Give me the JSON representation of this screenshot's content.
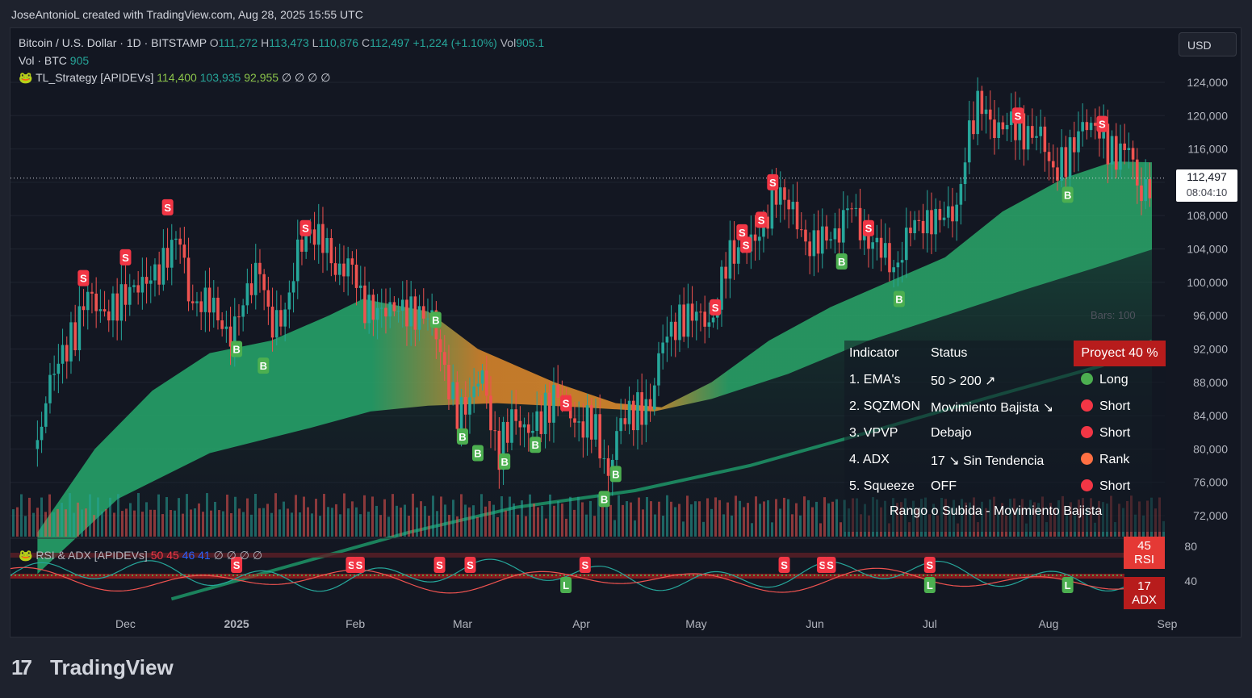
{
  "header": {
    "credit": "JoseAntonioL created with TradingView.com, Aug 28, 2025 15:55 UTC"
  },
  "legend": {
    "symbol": "Bitcoin / U.S. Dollar · 1D · BITSTAMP",
    "o_label": "O",
    "o_value": "111,272",
    "h_label": "H",
    "h_value": "113,473",
    "l_label": "L",
    "l_value": "110,876",
    "c_label": "C",
    "c_value": "112,497",
    "change": "+1,224 (+1.10%)",
    "vol_label": "Vol",
    "vol_value": "905.1",
    "vol_line_label": "Vol · BTC",
    "vol_line_value": "905",
    "strategy_name": "TL_Strategy [APIDEVs]",
    "strategy_v1": "114,400",
    "strategy_v2": "103,935",
    "strategy_v3": "92,955",
    "strategy_rest": "∅ ∅ ∅ ∅",
    "rsi_name": "RSI & ADX [APIDEVs]",
    "rsi_v1": "50",
    "rsi_v2": "45",
    "rsi_v3": "46",
    "rsi_v4": "41",
    "rsi_rest": "∅ ∅ ∅ ∅"
  },
  "currency": "USD",
  "price_tag": {
    "price": "112,497",
    "countdown": "08:04:10"
  },
  "bars_label": "Bars: 100",
  "table": {
    "headers": [
      "Indicator",
      "Status",
      "Proyect 40 %"
    ],
    "rows": [
      {
        "indicator": "1. EMA's",
        "status": "50 > 200 ↗",
        "signal": "Long",
        "color": "#4caf50"
      },
      {
        "indicator": "2. SQZMON",
        "status": "Movimiento Bajista ↘",
        "signal": "Short",
        "color": "#f23645"
      },
      {
        "indicator": "3. VPVP",
        "status": "Debajo",
        "signal": "Short",
        "color": "#f23645"
      },
      {
        "indicator": "4. ADX",
        "status": "17 ↘ Sin Tendencia",
        "signal": "Rank",
        "color": "#ff7043"
      },
      {
        "indicator": "5. Squeeze",
        "status": "OFF",
        "signal": "Short",
        "color": "#f23645"
      }
    ],
    "footer": "Rango o Subida - Movimiento Bajista"
  },
  "rsi_tag": {
    "value": "45",
    "label": "RSI"
  },
  "adx_tag": {
    "value": "17",
    "label": "ADX"
  },
  "brand": {
    "mark": "17",
    "name": "TradingView"
  },
  "chart_data": {
    "type": "candlestick",
    "y_ticks": [
      124000,
      120000,
      116000,
      112000,
      108000,
      104000,
      100000,
      96000,
      92000,
      88000,
      84000,
      80000,
      76000,
      72000
    ],
    "y_labels_shown": [
      "124,000",
      "120,000",
      "116,000",
      "108,000",
      "104,000",
      "100,000",
      "96,000",
      "92,000",
      "88,000",
      "84,000",
      "80,000",
      "76,000",
      "72,000"
    ],
    "rsi_ticks": [
      "80",
      "40"
    ],
    "x_labels": [
      "Dec",
      "2025",
      "Feb",
      "Mar",
      "Apr",
      "May",
      "Jun",
      "Jul",
      "Aug",
      "Sep"
    ],
    "close_path": [
      [
        "2024-11-10",
        80000
      ],
      [
        "2024-11-13",
        88000
      ],
      [
        "2024-11-16",
        91000
      ],
      [
        "2024-11-20",
        94000
      ],
      [
        "2024-11-23",
        99000
      ],
      [
        "2024-11-27",
        96000
      ],
      [
        "2024-11-30",
        97000
      ],
      [
        "2024-12-04",
        99000
      ],
      [
        "2024-12-08",
        100000
      ],
      [
        "2024-12-12",
        101500
      ],
      [
        "2024-12-17",
        106000
      ],
      [
        "2024-12-20",
        97000
      ],
      [
        "2024-12-25",
        98000
      ],
      [
        "2024-12-30",
        93000
      ],
      [
        "2025-01-03",
        98000
      ],
      [
        "2025-01-07",
        102000
      ],
      [
        "2025-01-10",
        94500
      ],
      [
        "2025-01-14",
        96500
      ],
      [
        "2025-01-17",
        104000
      ],
      [
        "2025-01-20",
        106000
      ],
      [
        "2025-01-24",
        105000
      ],
      [
        "2025-01-27",
        101000
      ],
      [
        "2025-01-31",
        102500
      ],
      [
        "2025-02-03",
        97000
      ],
      [
        "2025-02-07",
        96500
      ],
      [
        "2025-02-12",
        97000
      ],
      [
        "2025-02-17",
        96000
      ],
      [
        "2025-02-21",
        96000
      ],
      [
        "2025-02-25",
        88000
      ],
      [
        "2025-02-28",
        84000
      ],
      [
        "2025-03-03",
        86000
      ],
      [
        "2025-03-06",
        89500
      ],
      [
        "2025-03-10",
        79000
      ],
      [
        "2025-03-14",
        84000
      ],
      [
        "2025-03-18",
        82000
      ],
      [
        "2025-03-22",
        84000
      ],
      [
        "2025-03-26",
        87000
      ],
      [
        "2025-03-31",
        82500
      ],
      [
        "2025-04-04",
        83500
      ],
      [
        "2025-04-08",
        76500
      ],
      [
        "2025-04-11",
        83500
      ],
      [
        "2025-04-15",
        84500
      ],
      [
        "2025-04-19",
        85000
      ],
      [
        "2025-04-22",
        93000
      ],
      [
        "2025-04-26",
        95000
      ],
      [
        "2025-05-01",
        96500
      ],
      [
        "2025-05-05",
        94500
      ],
      [
        "2025-05-09",
        103000
      ],
      [
        "2025-05-13",
        104000
      ],
      [
        "2025-05-18",
        106000
      ],
      [
        "2025-05-22",
        111000
      ],
      [
        "2025-05-26",
        109000
      ],
      [
        "2025-05-30",
        104000
      ],
      [
        "2025-06-03",
        105500
      ],
      [
        "2025-06-07",
        105500
      ],
      [
        "2025-06-10",
        110000
      ],
      [
        "2025-06-14",
        105000
      ],
      [
        "2025-06-18",
        104500
      ],
      [
        "2025-06-22",
        101000
      ],
      [
        "2025-06-26",
        107000
      ],
      [
        "2025-06-30",
        107000
      ],
      [
        "2025-07-04",
        108000
      ],
      [
        "2025-07-08",
        108500
      ],
      [
        "2025-07-11",
        117500
      ],
      [
        "2025-07-14",
        122000
      ],
      [
        "2025-07-18",
        118000
      ],
      [
        "2025-07-22",
        119500
      ],
      [
        "2025-07-26",
        117500
      ],
      [
        "2025-07-30",
        118000
      ],
      [
        "2025-08-02",
        113000
      ],
      [
        "2025-08-06",
        115000
      ],
      [
        "2025-08-10",
        119000
      ],
      [
        "2025-08-14",
        118500
      ],
      [
        "2025-08-18",
        115000
      ],
      [
        "2025-08-22",
        116500
      ],
      [
        "2025-08-25",
        110000
      ],
      [
        "2025-08-28",
        112497
      ]
    ],
    "ema_upper": [
      [
        "2024-11-10",
        70000
      ],
      [
        "2024-11-25",
        80000
      ],
      [
        "2024-12-10",
        87000
      ],
      [
        "2024-12-25",
        91500
      ],
      [
        "2025-01-10",
        93000
      ],
      [
        "2025-01-25",
        96000
      ],
      [
        "2025-02-03",
        98000
      ],
      [
        "2025-02-20",
        96500
      ],
      [
        "2025-03-05",
        92000
      ],
      [
        "2025-03-25",
        88000
      ],
      [
        "2025-04-10",
        85500
      ],
      [
        "2025-04-22",
        85000
      ],
      [
        "2025-05-05",
        88000
      ],
      [
        "2025-05-20",
        93000
      ],
      [
        "2025-06-05",
        97000
      ],
      [
        "2025-06-20",
        100000
      ],
      [
        "2025-07-05",
        103000
      ],
      [
        "2025-07-20",
        108500
      ],
      [
        "2025-08-05",
        112500
      ],
      [
        "2025-08-18",
        114500
      ],
      [
        "2025-08-28",
        114400
      ]
    ],
    "ema_lower": [
      [
        "2024-11-10",
        65000
      ],
      [
        "2024-12-01",
        74000
      ],
      [
        "2024-12-25",
        79500
      ],
      [
        "2025-01-20",
        82500
      ],
      [
        "2025-02-05",
        84500
      ],
      [
        "2025-02-20",
        85200
      ],
      [
        "2025-03-10",
        85500
      ],
      [
        "2025-04-01",
        85000
      ],
      [
        "2025-04-20",
        84500
      ],
      [
        "2025-05-05",
        86000
      ],
      [
        "2025-05-25",
        89000
      ],
      [
        "2025-06-15",
        93000
      ],
      [
        "2025-07-05",
        96000
      ],
      [
        "2025-07-25",
        99000
      ],
      [
        "2025-08-15",
        102000
      ],
      [
        "2025-08-28",
        103935
      ]
    ],
    "ema_200": [
      [
        "2024-12-15",
        62000
      ],
      [
        "2025-01-15",
        66000
      ],
      [
        "2025-02-15",
        70000
      ],
      [
        "2025-03-15",
        73000
      ],
      [
        "2025-04-15",
        75000
      ],
      [
        "2025-05-15",
        78000
      ],
      [
        "2025-06-15",
        82000
      ],
      [
        "2025-07-15",
        86000
      ],
      [
        "2025-08-15",
        90000
      ],
      [
        "2025-08-28",
        92955
      ]
    ],
    "buy_signals": [
      [
        "2025-01-01",
        92000
      ],
      [
        "2025-01-08",
        90000
      ],
      [
        "2025-02-22",
        95500
      ],
      [
        "2025-03-01",
        81500
      ],
      [
        "2025-03-05",
        79500
      ],
      [
        "2025-03-12",
        78500
      ],
      [
        "2025-03-20",
        80500
      ],
      [
        "2025-04-07",
        74000
      ],
      [
        "2025-04-10",
        77000
      ],
      [
        "2025-06-08",
        102500
      ],
      [
        "2025-06-23",
        98000
      ],
      [
        "2025-08-06",
        110500
      ]
    ],
    "sell_signals": [
      [
        "2024-11-22",
        100500
      ],
      [
        "2024-12-03",
        103000
      ],
      [
        "2024-12-14",
        109000
      ],
      [
        "2025-01-19",
        106500
      ],
      [
        "2025-03-28",
        85500
      ],
      [
        "2025-05-06",
        97000
      ],
      [
        "2025-05-13",
        106000
      ],
      [
        "2025-05-14",
        104500
      ],
      [
        "2025-05-18",
        107500
      ],
      [
        "2025-05-21",
        112000
      ],
      [
        "2025-06-15",
        106500
      ],
      [
        "2025-07-24",
        120000
      ],
      [
        "2025-08-15",
        119000
      ]
    ],
    "rsi_sell_signals": [
      "2025-01-01",
      "2025-01-31",
      "2025-02-02",
      "2025-02-23",
      "2025-03-03",
      "2025-04-02",
      "2025-05-24",
      "2025-06-03",
      "2025-06-05",
      "2025-07-01"
    ],
    "rsi_long_signals": [
      "2025-03-28",
      "2025-07-01",
      "2025-08-06"
    ]
  }
}
